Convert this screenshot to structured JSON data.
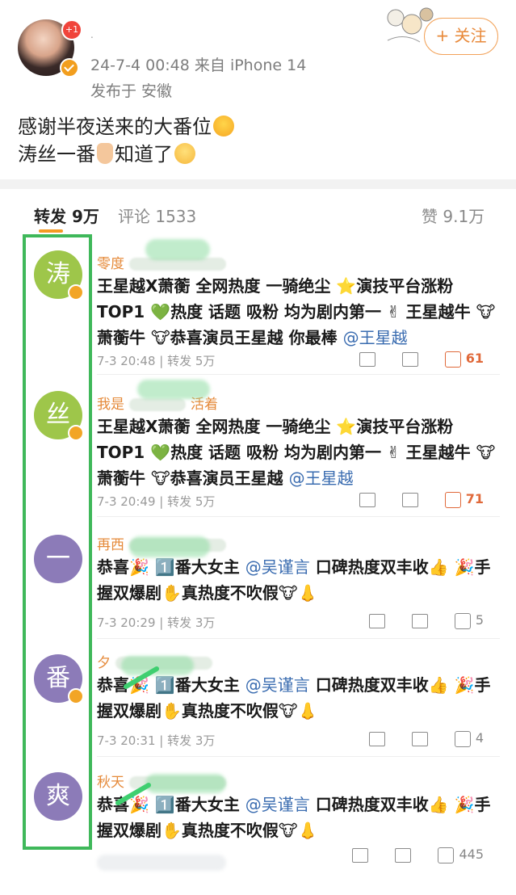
{
  "post": {
    "avatar_badge": "+1",
    "username": ".",
    "meta": "24-7-4 00:48  来自 iPhone 14",
    "location": "发布于 安徽",
    "follow_label": "+ 关注",
    "line1": "感谢半夜送来的大番位",
    "line2_a": "涛丝一番",
    "line2_b": "知道了"
  },
  "tabs": {
    "repost": "转发 9万",
    "comments": "评论 1533",
    "likes": "赞 9.1万"
  },
  "comments": [
    {
      "avatar_char": "涛",
      "name": "零度",
      "body_a": "王星越X萧蘅 全网热度 一骑绝尘 ⭐演技平台涨粉 TOP1 💚热度 话题 吸粉 均为剧内第一 ✌ 王星越牛 🐮萧蘅牛 🐮恭喜演员王星越 你最棒",
      "mention": "@王星越",
      "time": "7-3 20:48 | 转发 5万",
      "likes": "61"
    },
    {
      "avatar_char": "丝",
      "name": "我是",
      "name_tail": "活着",
      "body_a": "王星越X萧蘅 全网热度 一骑绝尘 ⭐演技平台涨粉 TOP1 💚热度 话题 吸粉 均为剧内第一 ✌ 王星越牛 🐮萧蘅牛 🐮恭喜演员王星越",
      "mention": "@王星越",
      "time": "7-3 20:49 | 转发 5万",
      "likes": "71"
    },
    {
      "avatar_char": "一",
      "name": "再西",
      "body_a": "恭喜🎉 1️⃣番大女主",
      "mention": "@吴谨言",
      "body_b": " 口碑热度双丰收👍 🎉手握双爆剧✋真热度不吹假🐮👃",
      "time": "7-3 20:29 | 转发 3万",
      "likes": "5"
    },
    {
      "avatar_char": "番",
      "name": "夕",
      "body_a": "恭喜🎉 1️⃣番大女主",
      "mention": "@吴谨言",
      "body_b": " 口碑热度双丰收👍 🎉手握双爆剧✋真热度不吹假🐮👃",
      "time": "7-3 20:31 | 转发 3万",
      "likes": "4"
    },
    {
      "avatar_char": "爽",
      "name": "秋天",
      "body_a": "恭喜🎉 1️⃣番大女主",
      "mention": "@吴谨言",
      "body_b": " 口碑热度双丰收👍 🎉手握双爆剧✋真热度不吹假🐮👃",
      "time": "",
      "likes": "445"
    }
  ],
  "colors": {
    "accent": "#f59a23",
    "link": "#3a6cb0",
    "highlight_box": "#3fb85a",
    "avatar_green": "#9ec64a",
    "avatar_purple": "#8c7bb8"
  }
}
